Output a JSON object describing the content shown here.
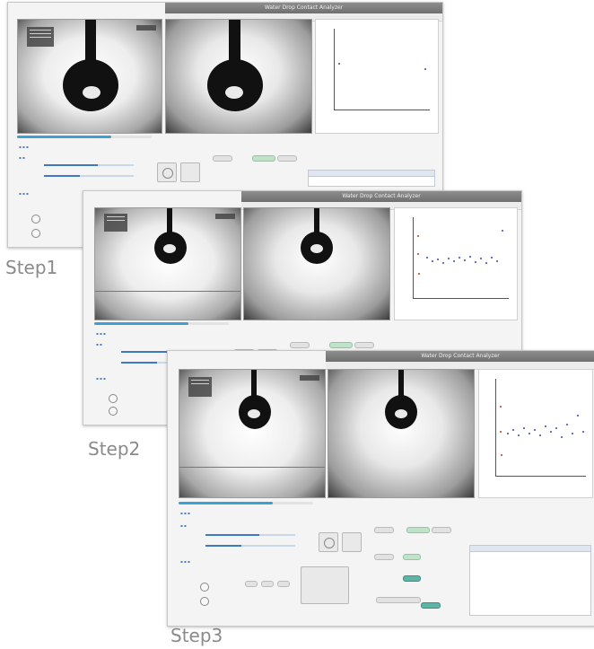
{
  "steps": [
    {
      "label": "Step1"
    },
    {
      "label": "Step2"
    },
    {
      "label": "Step3"
    }
  ],
  "window": {
    "title": "Water Drop Contact Analyzer"
  },
  "colors": {
    "accent": "#3aa0d8",
    "series_point": "#3b47a8",
    "fit_line": "#c0392b",
    "step_label": "#8a8a8a"
  },
  "icons": [
    "droplet-icon",
    "record-button-icon",
    "stop-button-icon"
  ]
}
